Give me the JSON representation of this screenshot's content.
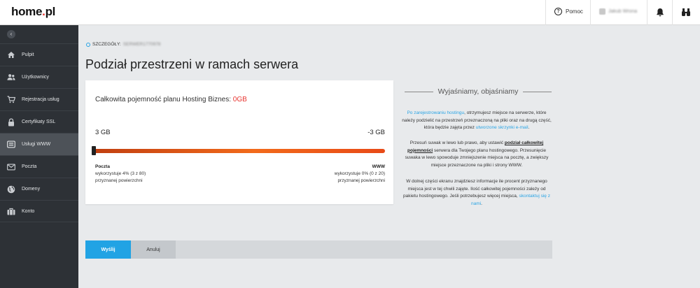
{
  "header": {
    "logo_main": "home",
    "logo_accent": ".",
    "logo_tail": "pl",
    "help_label": "Pomoc",
    "user_name": "Jakub Wrona"
  },
  "sidebar": {
    "items": [
      {
        "label": "Pulpit",
        "icon": "home-icon"
      },
      {
        "label": "Użytkownicy",
        "icon": "users-icon"
      },
      {
        "label": "Rejestracja usług",
        "icon": "cart-icon"
      },
      {
        "label": "Certyfikaty SSL",
        "icon": "lock-icon"
      },
      {
        "label": "Usługi WWW",
        "icon": "hosting-icon"
      },
      {
        "label": "Poczta",
        "icon": "mail-icon"
      },
      {
        "label": "Domeny",
        "icon": "globe-icon"
      },
      {
        "label": "Konto",
        "icon": "briefcase-icon"
      }
    ],
    "active_index": 4
  },
  "breadcrumb": {
    "label": "SZCZEGÓŁY:",
    "id": "SERWER1770978"
  },
  "page_title": "Podział przestrzeni w ramach serwera",
  "card": {
    "heading": "Całkowita pojemność planu Hosting Biznes:",
    "heading_value": "0GB",
    "left_amount": "3 GB",
    "right_amount": "-3 GB",
    "slider_position": 0,
    "left": {
      "name": "Poczta",
      "usage": "wykorzystuje 4% (3 z 80)",
      "caption": "przyznanej powierzchni"
    },
    "right": {
      "name": "WWW",
      "usage": "wykorzystuje 0% (0 z 20)",
      "caption": "przyznanej powierzchni"
    }
  },
  "info": {
    "heading": "Wyjaśniamy, objaśniamy",
    "p1_link1": "Po zarejestrowaniu hostingu",
    "p1_text1": ", otrzymujesz miejsce na serwerze, które należy podzielić na przestrzeń przeznaczoną na pliki oraz na drugą część, która będzie zajęta przez ",
    "p1_link2": "utworzone skrzynki e-mail",
    "p1_text2": ".",
    "p2_text1": "Przesuń suwak w lewo lub prawo, aby ustawić ",
    "p2_link": "podział całkowitej pojemności",
    "p2_text2": " serwera dla Twojego planu hostingowego. Przesunięcie suwaka w lewo spowoduje zmniejszenie miejsca na pocztę, a zwiększy miejsce przeznaczone na pliki i strony WWW.",
    "p3_text1": "W dolnej części ekranu znajdziesz informacje ile procent przyznanego miejsca jest w tej chwili zajęte. Ilość całkowitej pojemności zależy od pakietu hostingowego. Jeśli potrzebujesz więcej miejsca, ",
    "p3_link": "skontaktuj się z nami",
    "p3_text2": "."
  },
  "actions": {
    "send_label": "Wyślij",
    "cancel_label": "Anuluj"
  },
  "colors": {
    "accent": "#21a3e4",
    "brand_red": "#e8342f",
    "sidebar_bg": "#2d3136",
    "slider_orange": "#f26a1b"
  }
}
